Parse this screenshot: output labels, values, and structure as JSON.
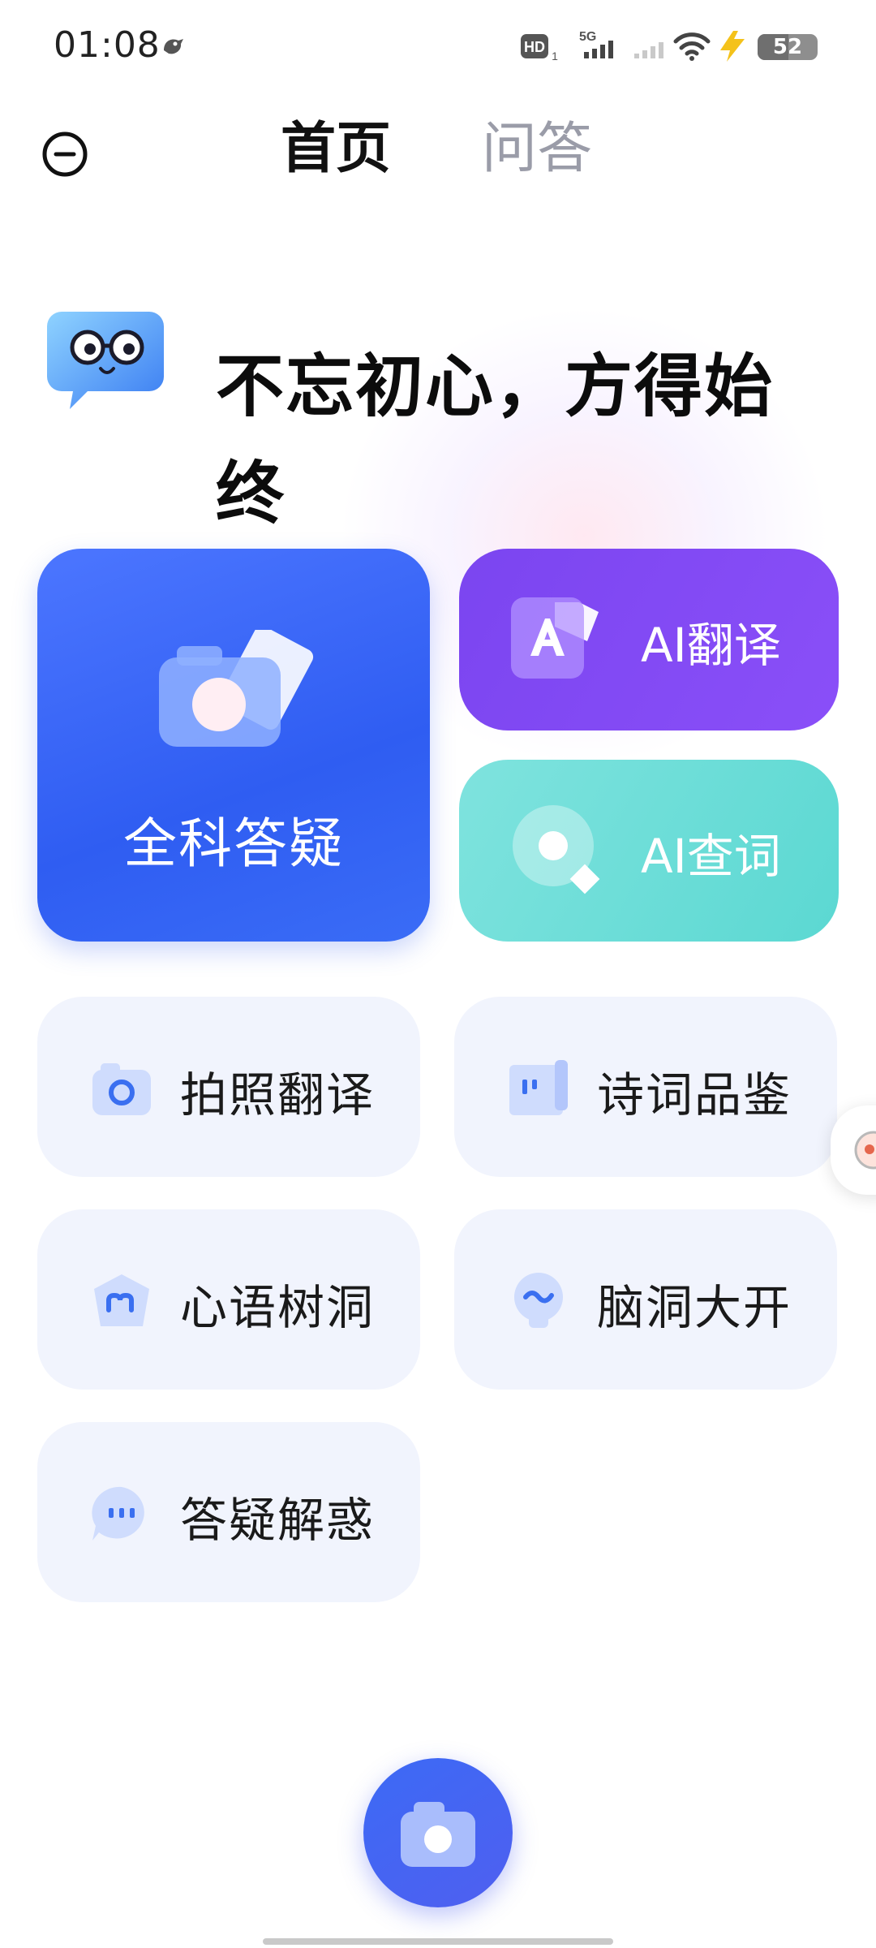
{
  "status_bar": {
    "time": "01:08",
    "hd_label": "HD",
    "sim_label": "1",
    "network_label": "5G",
    "battery": "52",
    "battery_level": 0.52
  },
  "header": {
    "tabs": [
      {
        "label": "首页",
        "active": true
      },
      {
        "label": "问答",
        "active": false
      }
    ]
  },
  "hero": {
    "slogan": "不忘初心，方得始终"
  },
  "cards": {
    "qa": {
      "label": "全科答疑",
      "icon": "camera-icon"
    },
    "translate": {
      "label": "AI翻译",
      "icon": "translate-icon"
    },
    "lookup": {
      "label": "AI查词",
      "icon": "magnifier-icon"
    }
  },
  "tiles": [
    {
      "label": "拍照翻译",
      "icon": "camera-icon"
    },
    {
      "label": "诗词品鉴",
      "icon": "book-icon"
    },
    {
      "label": "心语树洞",
      "icon": "heart-chat-icon"
    },
    {
      "label": "脑洞大开",
      "icon": "lightbulb-icon"
    },
    {
      "label": "答疑解惑",
      "icon": "chat-bubble-icon"
    }
  ],
  "colors": {
    "primary_blue": "#3461f4",
    "purple": "#8149f5",
    "teal": "#63dbd5",
    "tile_bg": "#f1f4fd",
    "icon_blue": "#3a6ff0"
  }
}
